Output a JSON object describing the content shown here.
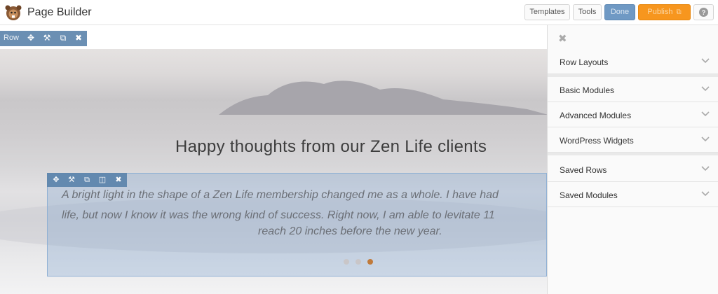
{
  "toolbar": {
    "title": "Page Builder",
    "templates_label": "Templates",
    "tools_label": "Tools",
    "done_label": "Done",
    "publish_label": "Publish",
    "help_label": "?"
  },
  "row_toolbar": {
    "label": "Row"
  },
  "content": {
    "heading": "Happy thoughts from our Zen Life clients",
    "quote_line1": "A bright light in the shape of a Zen Life membership changed me as a whole. I have had",
    "quote_line2": "life, but now I know it was the wrong kind of success. Right now, I am able to levitate 11",
    "quote_line3": "reach 20 inches before the new year."
  },
  "panel": {
    "sections": [
      {
        "label": "Row Layouts"
      },
      {
        "label": "Basic Modules"
      },
      {
        "label": "Advanced Modules"
      },
      {
        "label": "WordPress Widgets"
      },
      {
        "label": "Saved Rows"
      },
      {
        "label": "Saved Modules"
      }
    ]
  },
  "colors": {
    "done": "#6f99c4",
    "publish": "#f7961e",
    "row_toolbar": "#5f86ad"
  }
}
